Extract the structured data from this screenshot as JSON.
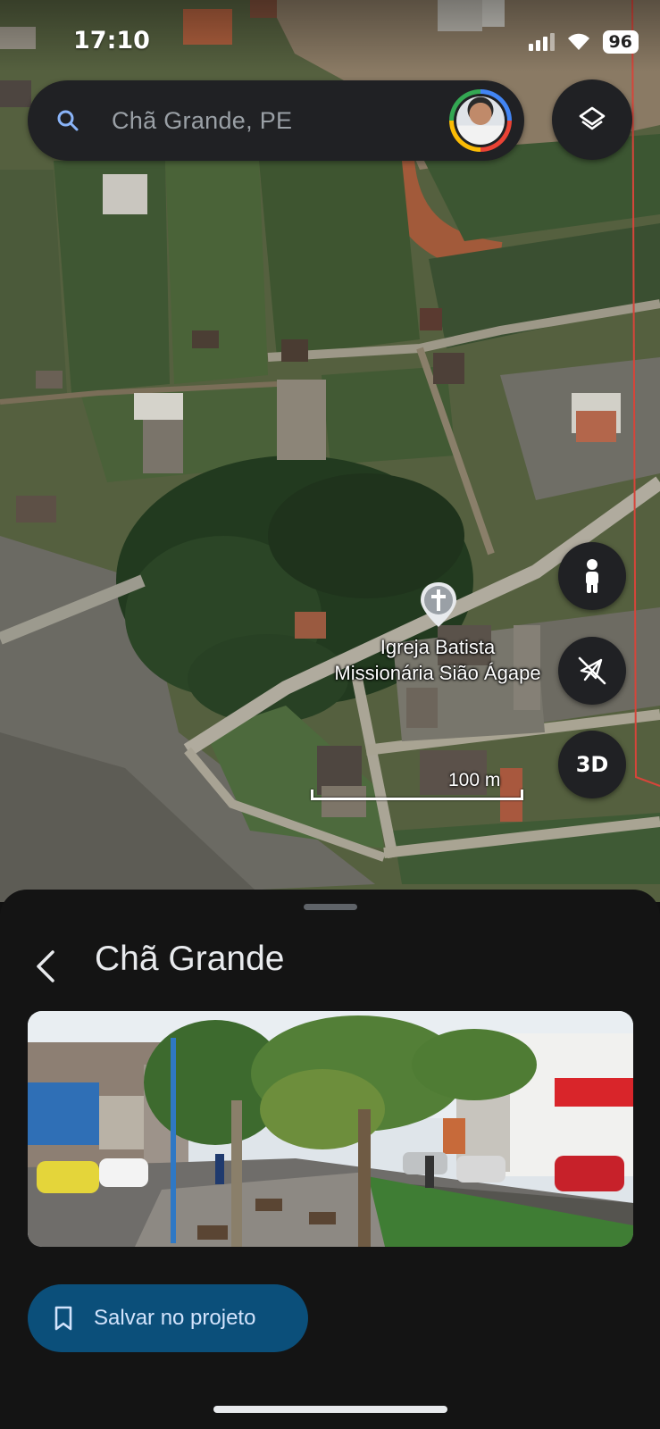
{
  "status_bar": {
    "time": "17:10",
    "battery": "96"
  },
  "search": {
    "query": "Chã Grande, PE"
  },
  "map": {
    "place_label_line1": "Igreja Batista",
    "place_label_line2": "Missionária Sião Ágape",
    "scale": "100 m",
    "button_3d": "3D"
  },
  "sheet": {
    "title": "Chã Grande",
    "save_button_label": "Salvar no projeto"
  },
  "colors": {
    "sheet_background": "#141414",
    "button_background": "#202124",
    "save_button": "#0b4f7a",
    "accent_text": "#d2e3fc"
  },
  "icons": [
    "search-icon",
    "avatar",
    "layers-icon",
    "pegman-icon",
    "compass-off-icon",
    "church-pin-icon",
    "back-arrow-icon",
    "bookmark-icon"
  ]
}
